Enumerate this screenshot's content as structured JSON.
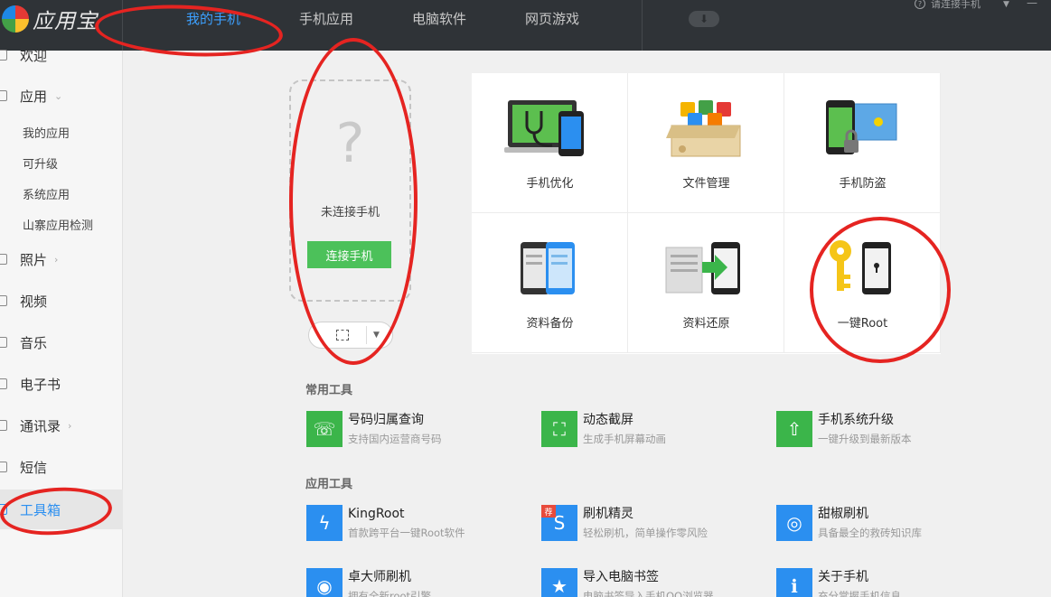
{
  "app": {
    "name": "应用宝"
  },
  "topnav": {
    "tabs": [
      {
        "label": "我的手机",
        "active": true
      },
      {
        "label": "手机应用"
      },
      {
        "label": "电脑软件"
      },
      {
        "label": "网页游戏"
      }
    ],
    "connect_status": "请连接手机",
    "accent_color": "#3ca0ff"
  },
  "sidebar": {
    "items": [
      {
        "label": "欢迎"
      },
      {
        "label": "应用",
        "expanded": true
      },
      {
        "label": "照片"
      },
      {
        "label": "视频"
      },
      {
        "label": "音乐"
      },
      {
        "label": "电子书"
      },
      {
        "label": "通讯录"
      },
      {
        "label": "短信"
      },
      {
        "label": "工具箱",
        "active": true
      }
    ],
    "sub_items": [
      "我的应用",
      "可升级",
      "系统应用",
      "山寨应用检测"
    ]
  },
  "phone": {
    "placeholder": "?",
    "status": "未连接手机",
    "connect_button": "连接手机"
  },
  "features": [
    {
      "label": "手机优化",
      "icon": "phone-optimize-icon"
    },
    {
      "label": "文件管理",
      "icon": "file-manage-icon"
    },
    {
      "label": "手机防盗",
      "icon": "anti-theft-icon"
    },
    {
      "label": "资料备份",
      "icon": "backup-icon"
    },
    {
      "label": "资料还原",
      "icon": "restore-icon"
    },
    {
      "label": "一键Root",
      "icon": "root-key-icon"
    }
  ],
  "common_tools": {
    "title": "常用工具",
    "items": [
      {
        "name": "号码归属查询",
        "desc": "支持国内运营商号码",
        "color": "#3bb54a"
      },
      {
        "name": "动态截屏",
        "desc": "生成手机屏幕动画",
        "color": "#3bb54a"
      },
      {
        "name": "手机系统升级",
        "desc": "一键升级到最新版本",
        "color": "#3bb54a"
      }
    ]
  },
  "app_tools": {
    "title": "应用工具",
    "items": [
      {
        "name": "KingRoot",
        "desc": "首款跨平台一键Root软件",
        "color": "#2b8ff0"
      },
      {
        "name": "刷机精灵",
        "desc": "轻松刷机，简单操作零风险",
        "color": "#2b8ff0",
        "badge": "荐"
      },
      {
        "name": "甜椒刷机",
        "desc": "具备最全的救砖知识库",
        "color": "#2b8ff0"
      },
      {
        "name": "卓大师刷机",
        "desc": "拥有全新root引擎",
        "color": "#2b8ff0"
      },
      {
        "name": "导入电脑书签",
        "desc": "电脑书签导入手机QQ浏览器",
        "color": "#2b8ff0"
      },
      {
        "name": "关于手机",
        "desc": "充分掌握手机信息",
        "color": "#2b8ff0"
      }
    ]
  }
}
